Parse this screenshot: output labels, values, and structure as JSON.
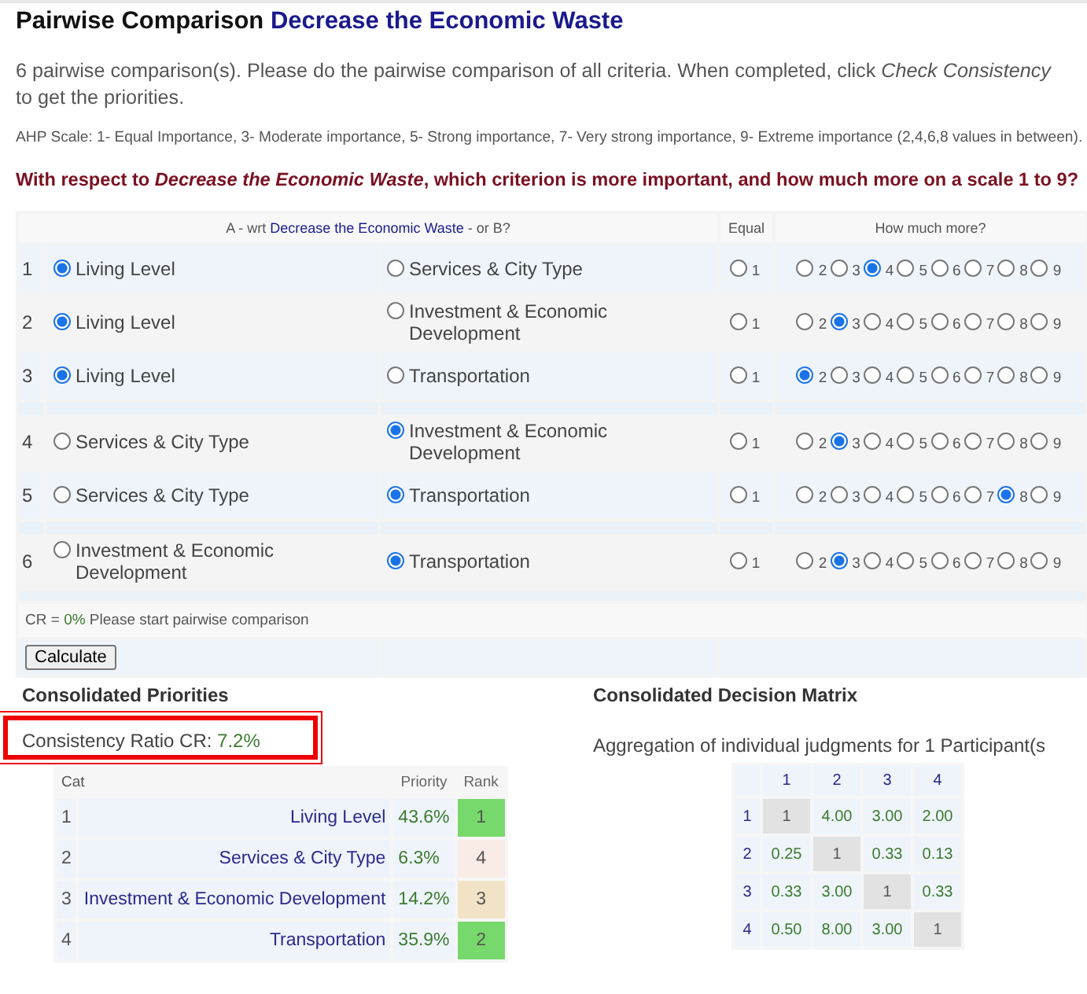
{
  "title": {
    "label": "Pairwise Comparison",
    "goal": "Decrease the Economic Waste"
  },
  "intro": "6 pairwise comparison(s). Please do the pairwise comparison of all criteria. When completed, click *Check Consistency* to get the priorities.",
  "scale_note": "AHP Scale: 1- Equal Importance, 3- Moderate importance, 5- Strong importance, 7- Very strong importance, 9- Extreme importance (2,4,6,8 values in between).",
  "question": "With respect to *Decrease the Economic Waste*, which criterion is more important, and how much more on a scale 1 to 9?",
  "comparison": {
    "header": {
      "prefix": "A - wrt",
      "goal": "Decrease the Economic Waste",
      "suffix": "- or B?",
      "equal": "Equal",
      "more": "How much more?"
    },
    "rows": [
      {
        "index": "1",
        "a": "Living Level",
        "b": "Services & City Type",
        "a_selected": true,
        "b_selected": false,
        "spacer_before": false,
        "options": [
          {
            "label": "1",
            "selected": false
          },
          {
            "label": "2",
            "selected": false
          },
          {
            "label": "3",
            "selected": false
          },
          {
            "label": "4",
            "selected": true
          },
          {
            "label": "5",
            "selected": false
          },
          {
            "label": "6",
            "selected": false
          },
          {
            "label": "7",
            "selected": false
          },
          {
            "label": "8",
            "selected": false
          },
          {
            "label": "9",
            "selected": false
          }
        ]
      },
      {
        "index": "2",
        "a": "Living Level",
        "b": "Investment & Economic Development",
        "a_selected": true,
        "b_selected": false,
        "spacer_before": false,
        "options": [
          {
            "label": "1",
            "selected": false
          },
          {
            "label": "2",
            "selected": false
          },
          {
            "label": "3",
            "selected": true
          },
          {
            "label": "4",
            "selected": false
          },
          {
            "label": "5",
            "selected": false
          },
          {
            "label": "6",
            "selected": false
          },
          {
            "label": "7",
            "selected": false
          },
          {
            "label": "8",
            "selected": false
          },
          {
            "label": "9",
            "selected": false
          }
        ]
      },
      {
        "index": "3",
        "a": "Living Level",
        "b": "Transportation",
        "a_selected": true,
        "b_selected": false,
        "spacer_before": false,
        "options": [
          {
            "label": "1",
            "selected": false
          },
          {
            "label": "2",
            "selected": true
          },
          {
            "label": "3",
            "selected": false
          },
          {
            "label": "4",
            "selected": false
          },
          {
            "label": "5",
            "selected": false
          },
          {
            "label": "6",
            "selected": false
          },
          {
            "label": "7",
            "selected": false
          },
          {
            "label": "8",
            "selected": false
          },
          {
            "label": "9",
            "selected": false
          }
        ]
      },
      {
        "index": "4",
        "a": "Services & City Type",
        "b": "Investment & Economic Development",
        "a_selected": false,
        "b_selected": true,
        "spacer_before": true,
        "options": [
          {
            "label": "1",
            "selected": false
          },
          {
            "label": "2",
            "selected": false
          },
          {
            "label": "3",
            "selected": true
          },
          {
            "label": "4",
            "selected": false
          },
          {
            "label": "5",
            "selected": false
          },
          {
            "label": "6",
            "selected": false
          },
          {
            "label": "7",
            "selected": false
          },
          {
            "label": "8",
            "selected": false
          },
          {
            "label": "9",
            "selected": false
          }
        ]
      },
      {
        "index": "5",
        "a": "Services & City Type",
        "b": "Transportation",
        "a_selected": false,
        "b_selected": true,
        "spacer_before": false,
        "options": [
          {
            "label": "1",
            "selected": false
          },
          {
            "label": "2",
            "selected": false
          },
          {
            "label": "3",
            "selected": false
          },
          {
            "label": "4",
            "selected": false
          },
          {
            "label": "5",
            "selected": false
          },
          {
            "label": "6",
            "selected": false
          },
          {
            "label": "7",
            "selected": false
          },
          {
            "label": "8",
            "selected": true
          },
          {
            "label": "9",
            "selected": false
          }
        ]
      },
      {
        "index": "6",
        "a": "Investment & Economic Development",
        "b": "Transportation",
        "a_selected": false,
        "b_selected": true,
        "spacer_before": true,
        "options": [
          {
            "label": "1",
            "selected": false
          },
          {
            "label": "2",
            "selected": false
          },
          {
            "label": "3",
            "selected": true
          },
          {
            "label": "4",
            "selected": false
          },
          {
            "label": "5",
            "selected": false
          },
          {
            "label": "6",
            "selected": false
          },
          {
            "label": "7",
            "selected": false
          },
          {
            "label": "8",
            "selected": false
          },
          {
            "label": "9",
            "selected": false
          }
        ]
      }
    ],
    "cr": {
      "label": "CR =",
      "value": "0%",
      "message": "Please start pairwise comparison"
    },
    "calculate": "Calculate"
  },
  "priorities": {
    "title": "Consolidated Priorities",
    "cr": {
      "label": "Consistency Ratio CR:",
      "value": "7.2%",
      "highlighted": true
    },
    "columns": [
      "Cat",
      "Priority",
      "Rank"
    ],
    "rows": [
      {
        "index": "1",
        "name": "Living Level",
        "priority": "43.6%",
        "rank": "1",
        "color": "#77d86b"
      },
      {
        "index": "2",
        "name": "Services & City Type",
        "priority": "6.3%",
        "rank": "4",
        "color": "#f9ece6"
      },
      {
        "index": "3",
        "name": "Investment & Economic Development",
        "priority": "14.2%",
        "rank": "3",
        "color": "#f2e2c6"
      },
      {
        "index": "4",
        "name": "Transportation",
        "priority": "35.9%",
        "rank": "2",
        "color": "#77d86b"
      }
    ]
  },
  "matrix": {
    "title": "Consolidated Decision Matrix",
    "caption": "Aggregation of individual judgments for 1 Participant(s",
    "columns": [
      "1",
      "2",
      "3",
      "4"
    ],
    "rows": [
      {
        "label": "1",
        "cells": [
          "1",
          "4.00",
          "3.00",
          "2.00"
        ]
      },
      {
        "label": "2",
        "cells": [
          "0.25",
          "1",
          "0.33",
          "0.13"
        ]
      },
      {
        "label": "3",
        "cells": [
          "0.33",
          "3.00",
          "1",
          "0.33"
        ]
      },
      {
        "label": "4",
        "cells": [
          "0.50",
          "8.00",
          "3.00",
          "1"
        ]
      }
    ]
  }
}
